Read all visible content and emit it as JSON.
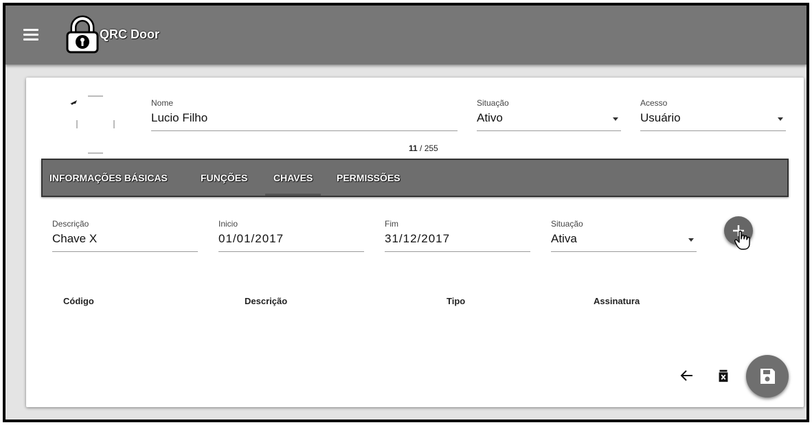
{
  "app": {
    "title": "QRC Door"
  },
  "profile": {
    "name_label": "Nome",
    "name_value": "Lucio Filho",
    "counter_current": "11",
    "counter_rest": " / 255",
    "status_label": "Situação",
    "status_value": "Ativo",
    "access_label": "Acesso",
    "access_value": "Usuário"
  },
  "tabs": [
    {
      "label": "INFORMAÇÕES BÁSICAS",
      "active": false
    },
    {
      "label": "FUNÇÕES",
      "active": false
    },
    {
      "label": "CHAVES",
      "active": true
    },
    {
      "label": "PERMISSÕES",
      "active": false
    }
  ],
  "key_form": {
    "description_label": "Descrição",
    "description_value": "Chave X",
    "start_label": "Inicio",
    "start_value": "01/01/2017",
    "end_label": "Fim",
    "end_value": "31/12/2017",
    "status_label": "Situação",
    "status_value": "Ativa"
  },
  "table": {
    "columns": [
      "Código",
      "Descrição",
      "Tipo",
      "Assinatura"
    ],
    "rows": []
  },
  "icons": {
    "menu": "menu-icon",
    "logo": "lock-icon",
    "add": "plus-icon",
    "back": "arrow-left-icon",
    "delete": "delete-icon",
    "save": "save-icon"
  },
  "colors": {
    "appbar": "#777777",
    "tabbar": "#6e6e6e",
    "fab": "#6f6f6f"
  }
}
